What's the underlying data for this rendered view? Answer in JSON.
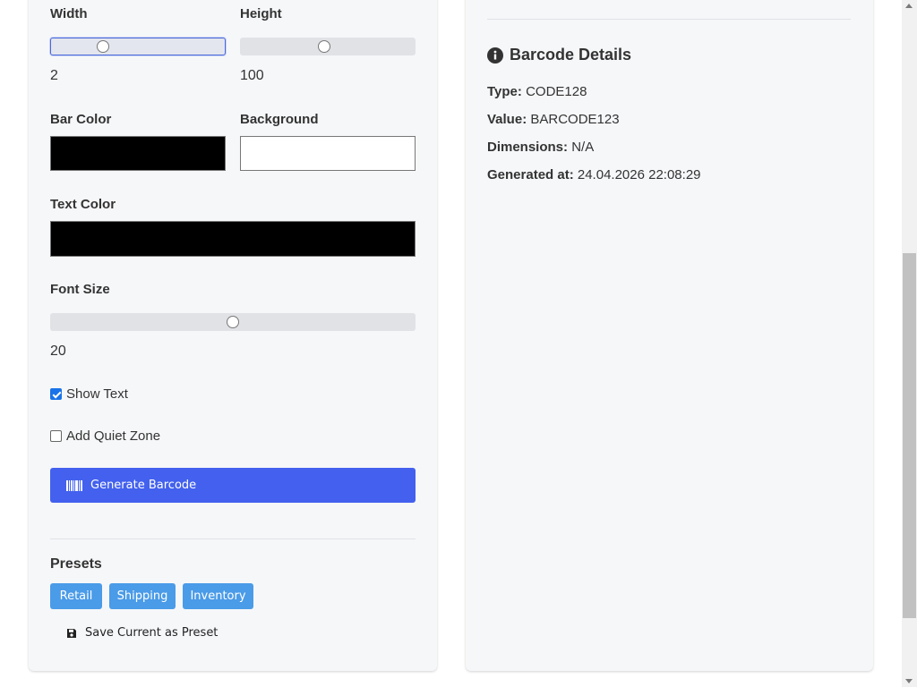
{
  "form": {
    "width": {
      "label": "Width",
      "value": "2",
      "fraction": 0.3
    },
    "height": {
      "label": "Height",
      "value": "100",
      "fraction": 0.48
    },
    "bar_color": {
      "label": "Bar Color",
      "color": "#000000"
    },
    "background": {
      "label": "Background",
      "color": "#ffffff"
    },
    "text_color": {
      "label": "Text Color",
      "color": "#000000"
    },
    "font_size": {
      "label": "Font Size",
      "value": "20",
      "fraction": 0.5
    },
    "show_text": {
      "label": "Show Text",
      "checked": true
    },
    "quiet_zone": {
      "label": "Add Quiet Zone",
      "checked": false
    },
    "generate_label": "Generate Barcode"
  },
  "presets": {
    "title": "Presets",
    "items": [
      "Retail",
      "Shipping",
      "Inventory"
    ],
    "save_label": "Save Current as Preset"
  },
  "details": {
    "title": "Barcode Details",
    "rows": [
      {
        "key": "Type:",
        "value": "CODE128"
      },
      {
        "key": "Value:",
        "value": "BARCODE123"
      },
      {
        "key": "Dimensions:",
        "value": "N/A"
      },
      {
        "key": "Generated at:",
        "value": "24.04.2026 22:08:29"
      }
    ]
  },
  "icons": {
    "generate": "barcode-icon",
    "details": "info-circle-icon",
    "save": "floppy-disk-icon"
  },
  "colors": {
    "primary": "#4361ee",
    "preset": "#4a9be8",
    "checkbox": "#1a73e8"
  }
}
